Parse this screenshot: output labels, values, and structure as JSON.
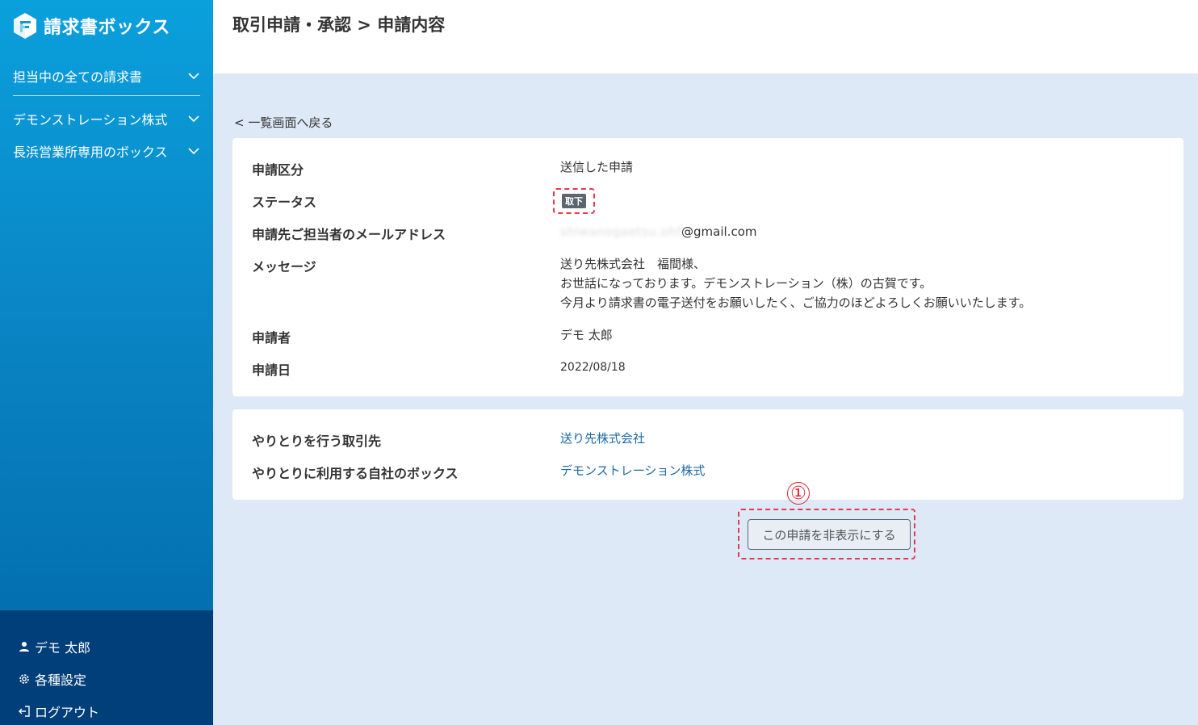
{
  "app": {
    "title": "請求書ボックス"
  },
  "sidebar": {
    "items": [
      {
        "label": "担当中の全ての請求書"
      },
      {
        "label": "デモンストレーション株式"
      },
      {
        "label": "長浜営業所専用のボックス"
      }
    ],
    "footer": {
      "user": "デモ 太郎",
      "settings": "各種設定",
      "logout": "ログアウト"
    }
  },
  "header": {
    "title": "取引申請・承認 > 申請内容"
  },
  "back_link": "< 一覧画面へ戻る",
  "details": {
    "category_label": "申請区分",
    "category_value": "送信した申請",
    "status_label": "ステータス",
    "status_badge": "取下",
    "email_label": "申請先ご担当者のメールアドレス",
    "email_hidden": "shiwanogaetsu.ohf",
    "email_domain": "@gmail.com",
    "message_label": "メッセージ",
    "message_line1": "送り先株式会社　福間様、",
    "message_line2": "お世話になっております。デモンストレーション（株）の古賀です。",
    "message_line3": "今月より請求書の電子送付をお願いしたく、ご協力のほどよろしくお願いいたします。",
    "applicant_label": "申請者",
    "applicant_value": "デモ 太郎",
    "date_label": "申請日",
    "date_value": "2022/08/18"
  },
  "partners": {
    "partner_label": "やりとりを行う取引先",
    "partner_value": "送り先株式会社",
    "box_label": "やりとりに利用する自社のボックス",
    "box_value": "デモンストレーション株式"
  },
  "annotation": "①",
  "hide_button": "この申請を非表示にする",
  "colors": {
    "accent": "#0a84c4",
    "link": "#1a6aa8",
    "highlight": "#e23a4f",
    "badge": "#5c6670"
  }
}
